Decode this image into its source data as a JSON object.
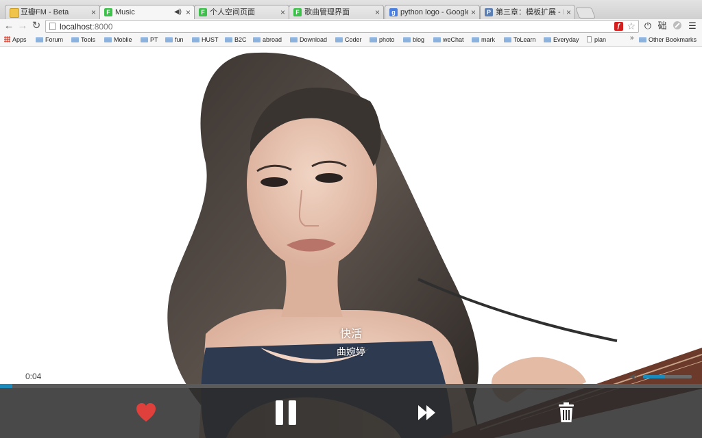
{
  "browser": {
    "tabs": [
      {
        "title": "豆瓣FM - Beta",
        "favicon": "douban-fm-icon",
        "active": false
      },
      {
        "title": "Music",
        "favicon": "fe-icon",
        "active": true,
        "audio": true
      },
      {
        "title": "个人空间页面",
        "favicon": "fe-icon",
        "active": false
      },
      {
        "title": "歌曲管理界面",
        "favicon": "fe-icon",
        "active": false
      },
      {
        "title": "python logo - Google Search",
        "favicon": "google-icon",
        "active": false
      },
      {
        "title": "第三章：模板扩展 - Introduction",
        "favicon": "p-icon",
        "active": false
      }
    ],
    "close_glyph": "×",
    "url": {
      "host": "localhost",
      "port": ":8000"
    },
    "extension_text": "础"
  },
  "bookmarks": {
    "apps": "Apps",
    "items": [
      "Forum",
      "Tools",
      "Moblie",
      "PT",
      "fun",
      "HUST",
      "B2C",
      "abroad",
      "Download",
      "Coder",
      "photo",
      "blog",
      "weChat",
      "mark",
      "ToLearn",
      "Everyday"
    ],
    "plan": "plan",
    "overflow": "»",
    "other": "Other Bookmarks"
  },
  "player": {
    "song_title": "快活",
    "artist": "曲婉婷",
    "elapsed": "0:04",
    "progress": 0.018,
    "volume": 0.45,
    "accent_color": "#1b8bbd",
    "heart_color": "#e0403b",
    "controls": [
      "heart-icon",
      "pause-icon",
      "next-icon",
      "trash-icon"
    ]
  }
}
